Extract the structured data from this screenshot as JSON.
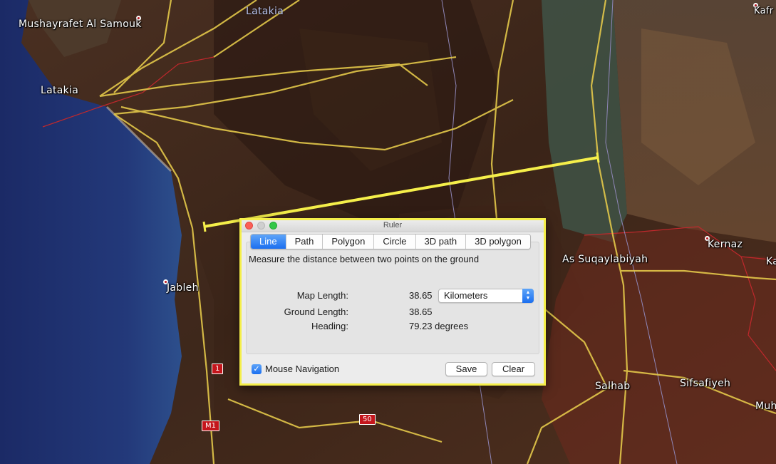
{
  "map": {
    "labels": {
      "mushayrafet": "Mushayrafet Al Samouk",
      "latakia_region": "Latakia",
      "latakia_city": "Latakia",
      "jableh": "Jableh",
      "as_suqaylabiyah": "As Suqaylabiyah",
      "kernaz": "Kernaz",
      "salhab": "Salhab",
      "sifsafiyeh": "Sifsafiyeh",
      "kafr_partial": "Kafr",
      "muh_partial": "Muh",
      "k_partial": "Ka"
    },
    "road_shields": {
      "r1": "1",
      "m1": "M1",
      "r50": "50"
    }
  },
  "ruler": {
    "window_title": "Ruler",
    "tabs": [
      "Line",
      "Path",
      "Polygon",
      "Circle",
      "3D path",
      "3D polygon"
    ],
    "active_tab": "Line",
    "description": "Measure the distance between two points on the ground",
    "map_length_label": "Map Length:",
    "map_length_value": "38.65",
    "unit": "Kilometers",
    "ground_length_label": "Ground Length:",
    "ground_length_value": "38.65",
    "heading_label": "Heading:",
    "heading_value": "79.23 degrees",
    "mouse_navigation_label": "Mouse Navigation",
    "mouse_navigation_checked": true,
    "save_label": "Save",
    "clear_label": "Clear"
  },
  "colors": {
    "ruler_line": "#f5ef4a",
    "road": "#e3c84a",
    "boundary": "#c0282c",
    "tab_active": "#1b6ff0"
  }
}
